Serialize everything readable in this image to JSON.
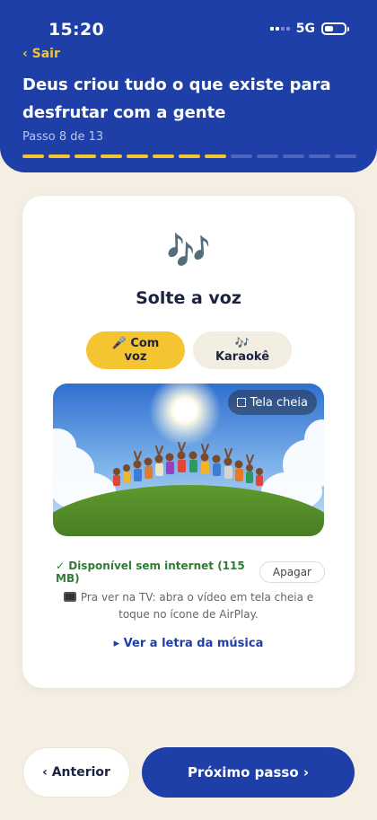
{
  "status_bar": {
    "time": "15:20",
    "network": "5G"
  },
  "header": {
    "back_label": "‹ Sair",
    "title": "Deus criou tudo o que existe para desfrutar com a gente",
    "step_label": "Passo 8 de 13",
    "progress": {
      "current": 8,
      "total": 13
    }
  },
  "card": {
    "icon": "🎶",
    "title": "Solte a voz",
    "modes": [
      {
        "label": "🎤 Com voz",
        "selected": true
      },
      {
        "label": "🎶 Karaokê",
        "selected": false
      }
    ],
    "video": {
      "fullscreen_label": "Tela cheia"
    },
    "offline": {
      "status": "✓ Disponível sem internet (115 MB)",
      "delete_label": "Apagar"
    },
    "tv_note": "Pra ver na TV: abra o vídeo em tela cheia e toque no ícone de AirPlay.",
    "lyrics_link": "▸ Ver a letra da música"
  },
  "nav": {
    "prev_label": "‹ Anterior",
    "next_label": "Próximo passo ›"
  },
  "colors": {
    "primary": "#1f3fa8",
    "accent": "#f5c531",
    "background": "#f5efe3",
    "success": "#2e7d32"
  }
}
